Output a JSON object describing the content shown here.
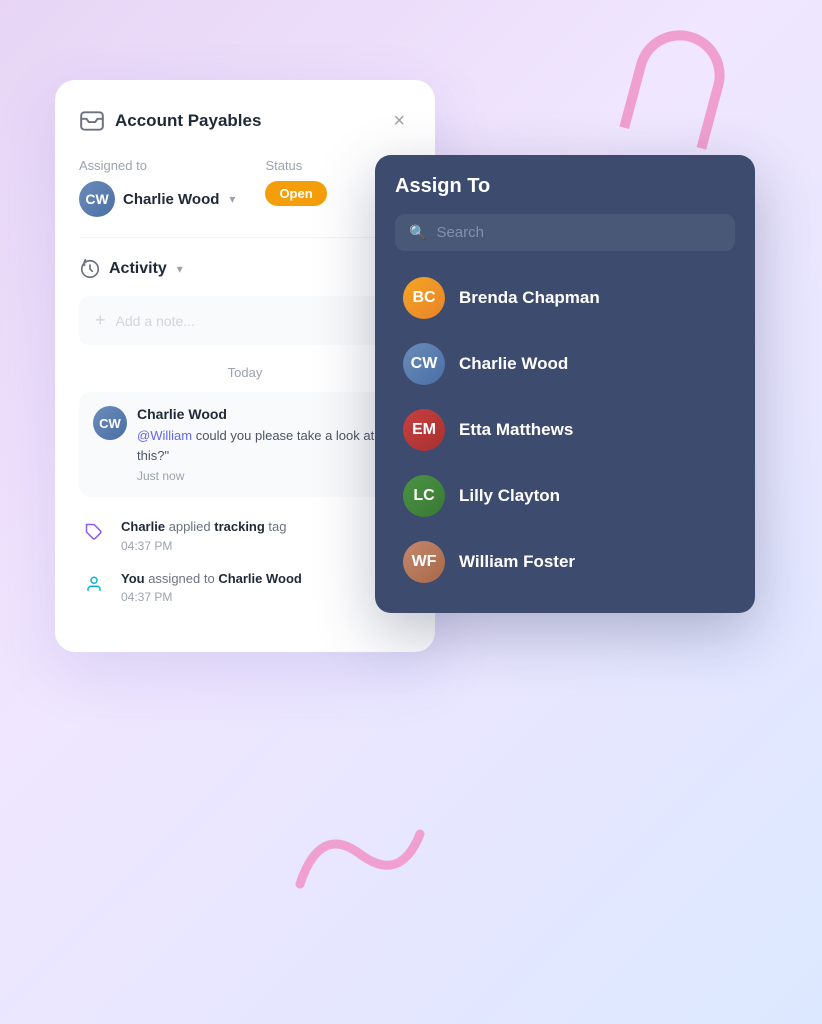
{
  "background": {
    "gradient_start": "#e8d5f5",
    "gradient_end": "#dce8ff"
  },
  "main_card": {
    "title": "Account Payables",
    "close_button": "×",
    "assigned_label": "Assigned to",
    "assigned_user": "Charlie Wood",
    "status_label": "Status",
    "status_value": "Open",
    "activity_title": "Activity",
    "add_note_placeholder": "Add a note...",
    "today_label": "Today",
    "comment": {
      "author": "Charlie Wood",
      "mention": "@William",
      "text": " could you please take a look at this?\"",
      "time": "Just now"
    },
    "activity_items": [
      {
        "actor": "Charlie",
        "action": " applied ",
        "highlight": "tracking",
        "suffix": " tag",
        "time": "04:37 PM",
        "icon_type": "tag"
      },
      {
        "actor": "You",
        "action": " assigned to ",
        "highlight": "Charlie Wood",
        "suffix": "",
        "time": "04:37 PM",
        "icon_type": "person"
      }
    ]
  },
  "assign_dropdown": {
    "title": "Assign To",
    "search_placeholder": "Search",
    "people": [
      {
        "name": "Brenda Chapman",
        "initials": "BC",
        "avatar_class": "av-brenda"
      },
      {
        "name": "Charlie Wood",
        "initials": "CW",
        "avatar_class": "av-charlie"
      },
      {
        "name": "Etta Matthews",
        "initials": "EM",
        "avatar_class": "av-etta"
      },
      {
        "name": "Lilly Clayton",
        "initials": "LC",
        "avatar_class": "av-lilly"
      },
      {
        "name": "William Foster",
        "initials": "WF",
        "avatar_class": "av-william"
      }
    ]
  }
}
